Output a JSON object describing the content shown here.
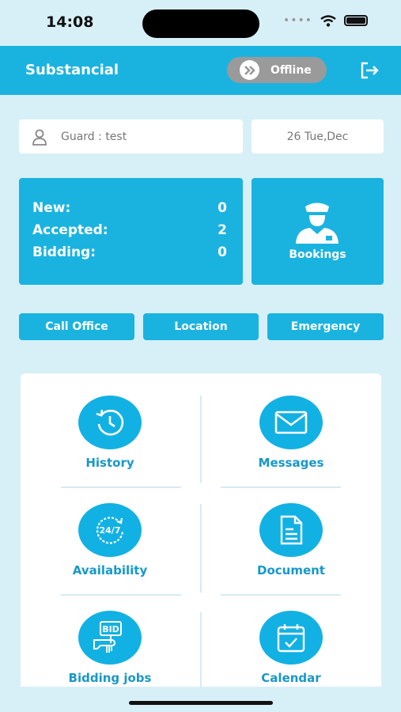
{
  "status_bar": {
    "time": "14:08"
  },
  "header": {
    "title": "Substancial",
    "toggle_label": "Offline"
  },
  "guard": {
    "text": "Guard : test"
  },
  "date": {
    "text": "26 Tue,Dec"
  },
  "stats": [
    {
      "label": "New:",
      "value": "0"
    },
    {
      "label": "Accepted:",
      "value": "2"
    },
    {
      "label": "Bidding:",
      "value": "0"
    }
  ],
  "bookings": {
    "label": "Bookings"
  },
  "actions": {
    "call": "Call Office",
    "location": "Location",
    "emergency": "Emergency"
  },
  "menu": [
    {
      "label": "History",
      "icon": "history-icon"
    },
    {
      "label": "Messages",
      "icon": "envelope-icon"
    },
    {
      "label": "Availability",
      "icon": "24-7-icon"
    },
    {
      "label": "Document",
      "icon": "document-icon"
    },
    {
      "label": "Bidding jobs",
      "icon": "bid-sign-icon"
    },
    {
      "label": "Calendar",
      "icon": "calendar-icon"
    }
  ],
  "icons": {
    "availability_text": "24/7",
    "bid_text": "BID"
  },
  "colors": {
    "primary": "#1ab3e0",
    "toggle_off": "#9a9a9a",
    "background": "#d7f0f8",
    "label": "#1898c9"
  }
}
